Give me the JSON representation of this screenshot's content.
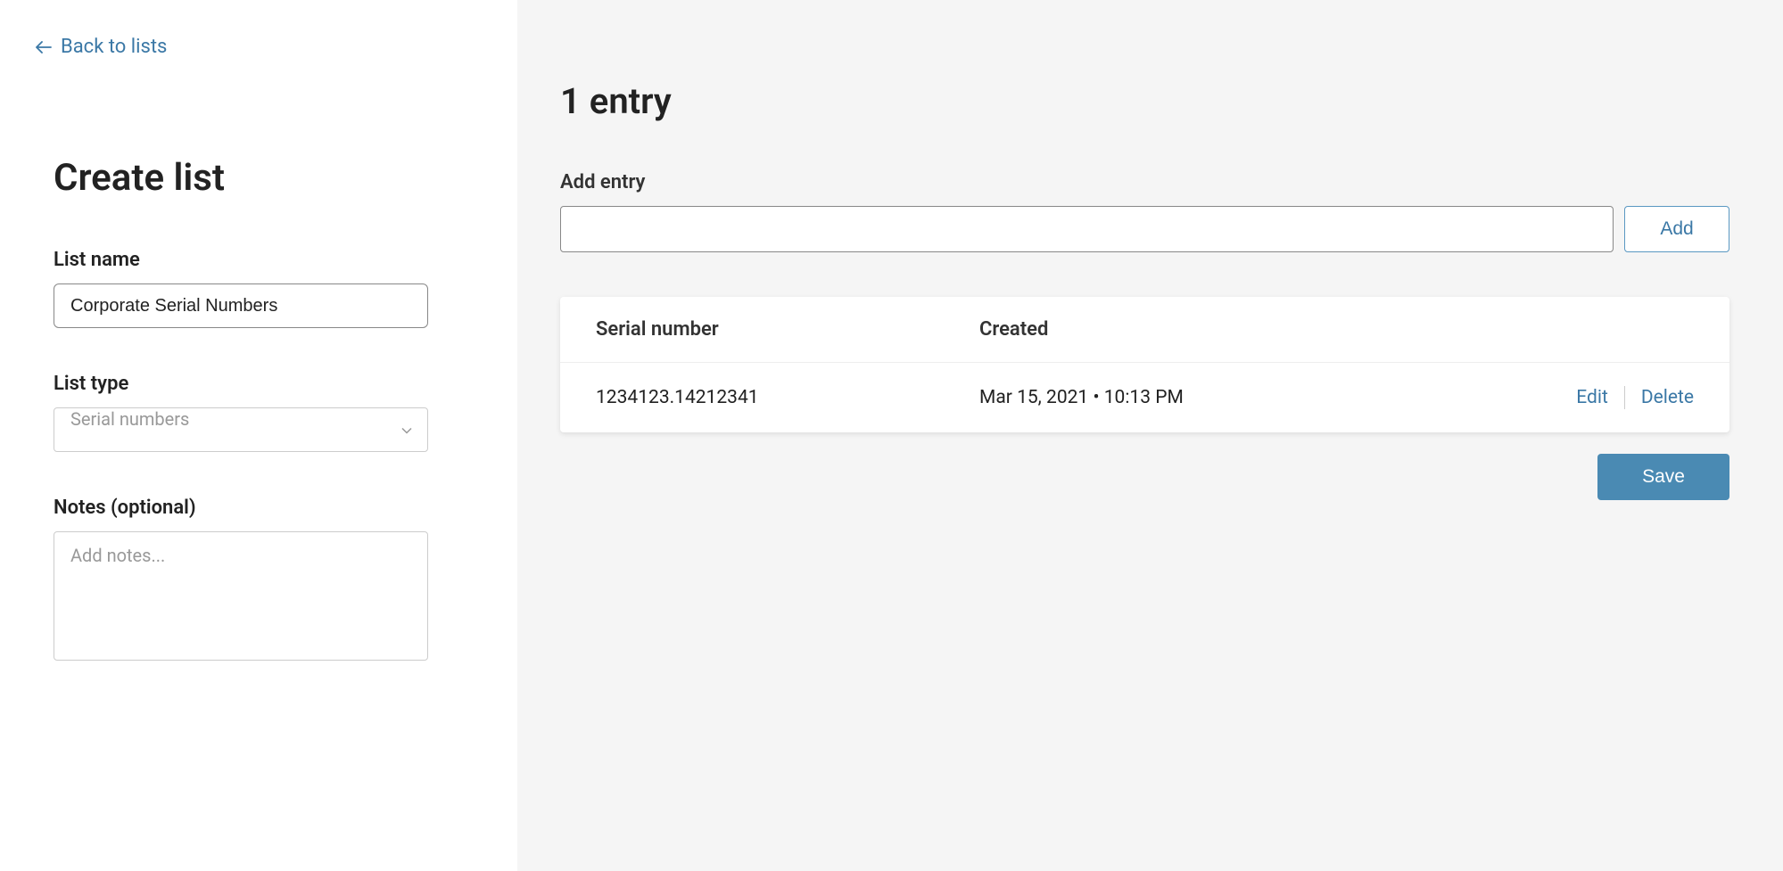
{
  "back_link": {
    "label": "Back to lists"
  },
  "form": {
    "title": "Create list",
    "list_name": {
      "label": "List name",
      "value": "Corporate Serial Numbers"
    },
    "list_type": {
      "label": "List type",
      "selected": "Serial numbers"
    },
    "notes": {
      "label": "Notes (optional)",
      "placeholder": "Add notes...",
      "value": ""
    }
  },
  "entries": {
    "title": "1 entry",
    "add_entry_label": "Add entry",
    "add_button": "Add",
    "columns": {
      "serial": "Serial number",
      "created": "Created"
    },
    "rows": [
      {
        "serial": "1234123.14212341",
        "created": "Mar 15, 2021 • 10:13 PM"
      }
    ],
    "actions": {
      "edit": "Edit",
      "delete": "Delete"
    },
    "save_button": "Save"
  }
}
